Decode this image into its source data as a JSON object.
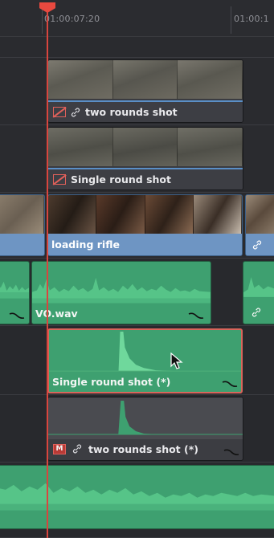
{
  "ruler": {
    "timecode_1": "01:00:07:20",
    "timecode_2": "01:00:1"
  },
  "video_clips": {
    "v3": {
      "label": "two rounds shot",
      "disabled": true,
      "linked": true
    },
    "v2": {
      "label": "Single round shot",
      "disabled": true,
      "linked": false
    },
    "v1_main": {
      "label": "loading rifle"
    }
  },
  "audio_clips": {
    "a_vo": {
      "label": "VO.wav"
    },
    "a_selected": {
      "label": "Single round shot (*)",
      "selected": true
    },
    "a_muted": {
      "label": "two rounds shot (*)",
      "mute_badge": "M",
      "linked": true
    }
  },
  "colors": {
    "playhead": "#e8493f",
    "video_bar": "#5a8fc7",
    "audio": "#3ea070",
    "selection": "#d9655b"
  }
}
